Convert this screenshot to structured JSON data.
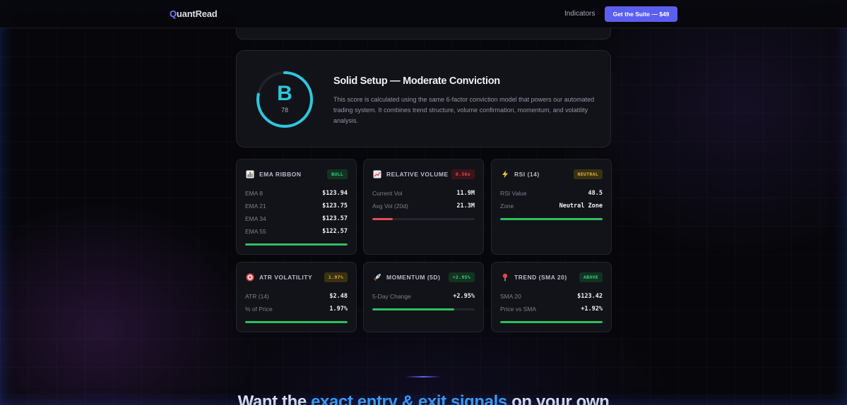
{
  "nav": {
    "logo_first": "Q",
    "logo_rest": "uantRead",
    "indicators_link": "Indicators",
    "cta_label": "Get the Suite — $49"
  },
  "score": {
    "grade": "B",
    "value": "78",
    "progress": 0.78,
    "title": "Solid Setup — Moderate Conviction",
    "description": "This score is calculated using the same 6-factor conviction model that powers our automated trading system. It combines trend structure, volume confirmation, momentum, and volatility analysis.",
    "accent": "#2cc7e0"
  },
  "cards": {
    "ema": {
      "icon": "bar-chart-icon",
      "title": "EMA RIBBON",
      "badge": "BULL",
      "rows": [
        {
          "label": "EMA 8",
          "value": "$123.94"
        },
        {
          "label": "EMA 21",
          "value": "$123.75"
        },
        {
          "label": "EMA 34",
          "value": "$123.57"
        },
        {
          "label": "EMA 55",
          "value": "$122.57"
        }
      ],
      "bar_fraction": 1.0,
      "bar_color": "#2fbf5e"
    },
    "volume": {
      "icon": "trend-chart-icon",
      "title": "RELATIVE VOLUME",
      "badge": "0.56x",
      "rows": [
        {
          "label": "Current Vol",
          "value": "11.9M"
        },
        {
          "label": "Avg Vol (20d)",
          "value": "21.3M"
        }
      ],
      "bar_fraction": 0.2,
      "bar_color": "#e24b52"
    },
    "rsi": {
      "icon": "lightning-icon",
      "title": "RSI (14)",
      "badge": "NEUTRAL",
      "rows": [
        {
          "label": "RSI Value",
          "value": "48.5"
        },
        {
          "label": "Zone",
          "value": "Neutral Zone"
        }
      ],
      "bar_fraction": 1.0,
      "bar_color": "#2fbf5e"
    },
    "atr": {
      "icon": "target-icon",
      "title": "ATR VOLATILITY",
      "badge": "1.97%",
      "rows": [
        {
          "label": "ATR (14)",
          "value": "$2.48"
        },
        {
          "label": "% of Price",
          "value": "1.97%"
        }
      ],
      "bar_fraction": 1.0,
      "bar_color": "#2fbf5e"
    },
    "momentum": {
      "icon": "rocket-icon",
      "title": "MOMENTUM (5D)",
      "badge": "+2.95%",
      "rows": [
        {
          "label": "5-Day Change",
          "value": "+2.95%"
        }
      ],
      "bar_fraction": 0.8,
      "bar_color": "#2fbf5e"
    },
    "trend": {
      "icon": "pin-icon",
      "title": "TREND (SMA 20)",
      "badge": "ABOVE",
      "rows": [
        {
          "label": "SMA 20",
          "value": "$123.42"
        },
        {
          "label": "Price vs SMA",
          "value": "+1.92%"
        }
      ],
      "bar_fraction": 1.0,
      "bar_color": "#2fbf5e"
    }
  },
  "cta": {
    "heading_start": "Want the ",
    "heading_highlight": "exact entry & exit signals",
    "heading_end": " on your own"
  }
}
